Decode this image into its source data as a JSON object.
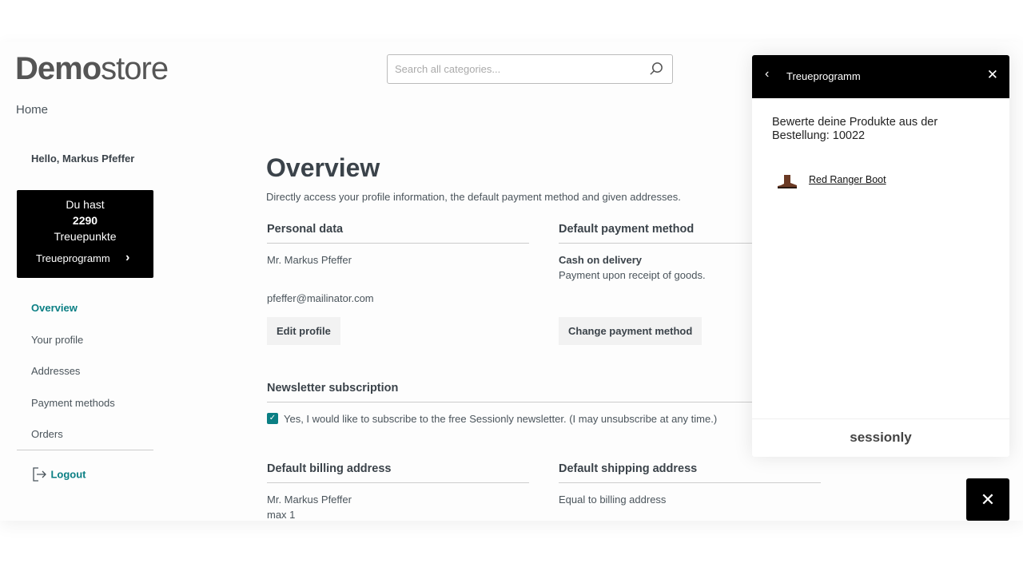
{
  "header": {
    "logo_bold": "Demo",
    "logo_light": "store",
    "search_placeholder": "Search all categories...",
    "nav_home": "Home"
  },
  "sidebar": {
    "greeting": "Hello, Markus Pfeffer",
    "loyalty": {
      "line1": "Du hast",
      "points": "2290",
      "line3": "Treuepunkte",
      "link": "Treueprogramm"
    },
    "items": [
      {
        "label": "Overview",
        "active": true
      },
      {
        "label": "Your profile"
      },
      {
        "label": "Addresses"
      },
      {
        "label": "Payment methods"
      },
      {
        "label": "Orders"
      }
    ],
    "logout": "Logout"
  },
  "main": {
    "title": "Overview",
    "subtitle": "Directly access your profile information, the default payment method and given addresses.",
    "personal": {
      "heading": "Personal data",
      "name": "Mr. Markus Pfeffer",
      "email": "pfeffer@mailinator.com",
      "button": "Edit profile"
    },
    "payment": {
      "heading": "Default payment method",
      "method": "Cash on delivery",
      "desc": "Payment upon receipt of goods.",
      "button": "Change payment method"
    },
    "newsletter": {
      "heading": "Newsletter subscription",
      "label": "Yes, I would like to subscribe to the free Sessionly newsletter. (I may unsubscribe at any time.)",
      "checked": true
    },
    "billing": {
      "heading": "Default billing address",
      "name": "Mr. Markus Pfeffer",
      "line2": "max 1"
    },
    "shipping": {
      "heading": "Default shipping address",
      "text": "Equal to billing address"
    }
  },
  "panel": {
    "title": "Treueprogramm",
    "message": "Bewerte deine Produkte aus der Bestellung: 10022",
    "product": "Red Ranger Boot",
    "footer_brand": "sessionly"
  },
  "colors": {
    "accent": "#0b7f84",
    "dark": "#000000"
  }
}
